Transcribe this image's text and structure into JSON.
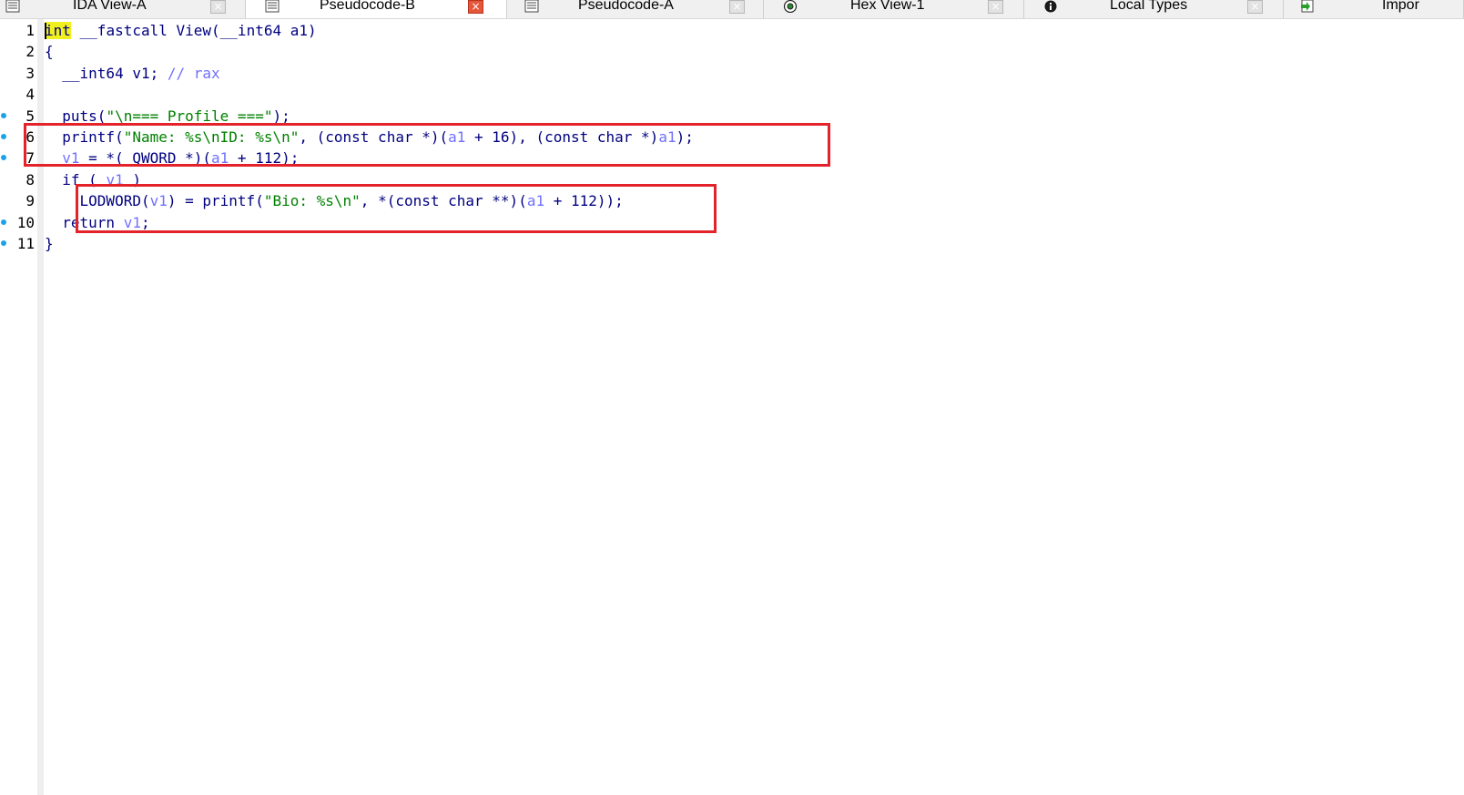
{
  "tabs": [
    {
      "label": "IDA View-A",
      "icon": "list-view-icon",
      "active": false
    },
    {
      "label": "Pseudocode-B",
      "icon": "list-view-icon",
      "active": true
    },
    {
      "label": "Pseudocode-A",
      "icon": "list-view-icon",
      "active": false
    },
    {
      "label": "Hex View-1",
      "icon": "hex-view-icon",
      "active": false
    },
    {
      "label": "Local Types",
      "icon": "info-icon",
      "active": false
    },
    {
      "label": "Impor",
      "icon": "imports-icon",
      "active": false
    }
  ],
  "close_glyph": "×",
  "code": {
    "line_numbers": [
      "1",
      "2",
      "3",
      "4",
      "5",
      "6",
      "7",
      "8",
      "9",
      "10",
      "11"
    ],
    "lines": [
      [
        {
          "t": "int",
          "c": "hl kw"
        },
        {
          "t": " __fastcall View(__int64 a1)",
          "c": "kw"
        }
      ],
      [
        {
          "t": "{",
          "c": "kw"
        }
      ],
      [
        {
          "t": "  __int64 v1; ",
          "c": "kw"
        },
        {
          "t": "// rax",
          "c": "cm"
        }
      ],
      [
        {
          "t": "",
          "c": "kw"
        }
      ],
      [
        {
          "t": "  puts(",
          "c": "kw"
        },
        {
          "t": "\"\\n=== Profile ===\"",
          "c": "str"
        },
        {
          "t": ");",
          "c": "kw"
        }
      ],
      [
        {
          "t": "  printf(",
          "c": "kw"
        },
        {
          "t": "\"Name: %s\\nID: %s\\n\"",
          "c": "str"
        },
        {
          "t": ", (const char *)(",
          "c": "kw"
        },
        {
          "t": "a1",
          "c": "var"
        },
        {
          "t": " + 16), (const char *)",
          "c": "kw"
        },
        {
          "t": "a1",
          "c": "var"
        },
        {
          "t": ");",
          "c": "kw"
        }
      ],
      [
        {
          "t": "  ",
          "c": "kw"
        },
        {
          "t": "v1",
          "c": "var"
        },
        {
          "t": " = *(_QWORD *)(",
          "c": "kw"
        },
        {
          "t": "a1",
          "c": "var"
        },
        {
          "t": " + 112);",
          "c": "kw"
        }
      ],
      [
        {
          "t": "  if ( ",
          "c": "kw"
        },
        {
          "t": "v1",
          "c": "var"
        },
        {
          "t": " )",
          "c": "kw"
        }
      ],
      [
        {
          "t": "    LODWORD(",
          "c": "kw"
        },
        {
          "t": "v1",
          "c": "var"
        },
        {
          "t": ") = printf(",
          "c": "kw"
        },
        {
          "t": "\"Bio: %s\\n\"",
          "c": "str"
        },
        {
          "t": ", *(const char **)(",
          "c": "kw"
        },
        {
          "t": "a1",
          "c": "var"
        },
        {
          "t": " + 112));",
          "c": "kw"
        }
      ],
      [
        {
          "t": "  return ",
          "c": "kw"
        },
        {
          "t": "v1",
          "c": "var"
        },
        {
          "t": ";",
          "c": "kw"
        }
      ],
      [
        {
          "t": "}",
          "c": "kw"
        }
      ]
    ],
    "breakpoints": [
      false,
      false,
      false,
      false,
      true,
      true,
      true,
      false,
      false,
      true,
      true
    ]
  },
  "annotation_colors": {
    "box": "#e3222a"
  }
}
